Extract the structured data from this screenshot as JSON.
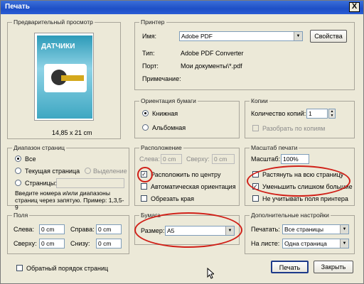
{
  "window": {
    "title": "Печать",
    "close_glyph": "X"
  },
  "preview": {
    "legend": "Предварительный просмотр",
    "size_label": "14,85 x 21 cm",
    "cover_title": "ДАТЧИКИ"
  },
  "printer": {
    "legend": "Принтер",
    "name_label": "Имя:",
    "name_value": "Adobe PDF",
    "properties_button": "Свойства",
    "type_label": "Тип:",
    "type_value": "Adobe PDF Converter",
    "port_label": "Порт:",
    "port_value": "Мои документы\\*.pdf",
    "comment_label": "Примечание:"
  },
  "orientation": {
    "legend": "Ориентация бумаги",
    "portrait": "Книжная",
    "landscape": "Альбомная"
  },
  "copies": {
    "legend": "Копии",
    "count_label": "Количество копий:",
    "count_value": "1",
    "collate_label": "Разобрать по копиям"
  },
  "range": {
    "legend": "Диапазон страниц",
    "all": "Все",
    "current": "Текущая страница",
    "selection": "Выделение",
    "pages": "Страницы:",
    "hint": "Введите номера и/или диапазоны страниц через запятую. Пример: 1,3,5-9"
  },
  "position": {
    "legend": "Расположение",
    "left_label": "Слева:",
    "left_value": "0 cm",
    "top_label": "Сверху:",
    "top_value": "0 cm",
    "center": "Расположить по центру",
    "auto_orient": "Автоматическая ориентация",
    "crop": "Обрезать края"
  },
  "scale": {
    "legend": "Масштаб печати",
    "label": "Масштаб:",
    "value": "100%",
    "fit": "Растянуть на всю страницу",
    "shrink": "Уменьшить слишком большие",
    "ignore_margins": "Не учитывать поля принтера"
  },
  "margins": {
    "legend": "Поля",
    "left_label": "Слева:",
    "left_value": "0 cm",
    "right_label": "Справа:",
    "right_value": "0 cm",
    "top_label": "Сверху:",
    "top_value": "0 cm",
    "bottom_label": "Снизу:",
    "bottom_value": "0 cm"
  },
  "paper": {
    "legend": "Бумага",
    "size_label": "Размер:",
    "size_value": "A5"
  },
  "advanced": {
    "legend": "Дополнительные настройки",
    "print_label": "Печатать:",
    "print_value": "Все страницы",
    "per_sheet_label": "На листе:",
    "per_sheet_value": "Одна страница"
  },
  "footer": {
    "reverse_label": "Обратный порядок страниц",
    "print_button": "Печать",
    "close_button": "Закрыть"
  },
  "colors": {
    "title_bar": "#1d4fc6",
    "dialog_bg": "#ece9d8",
    "annotation": "#d02018"
  }
}
